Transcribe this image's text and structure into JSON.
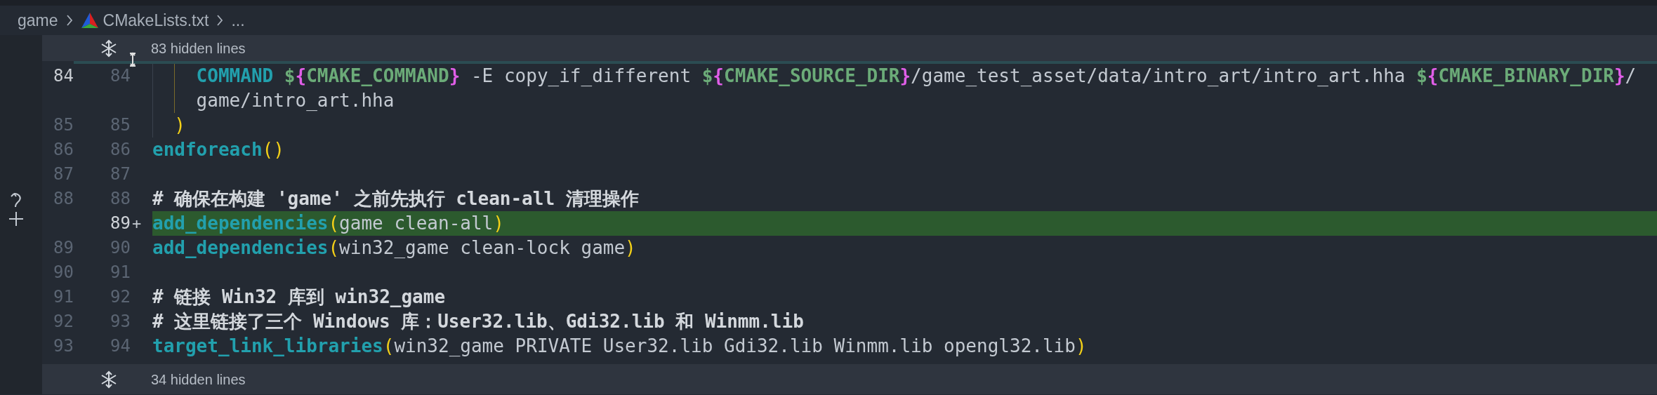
{
  "breadcrumb": [
    {
      "kind": "folder",
      "label": "game"
    },
    {
      "kind": "file",
      "label": "CMakeLists.txt"
    },
    {
      "kind": "more",
      "label": "..."
    }
  ],
  "fold_top": {
    "label": "83 hidden lines"
  },
  "rows": [
    {
      "kind": "context",
      "old": "84",
      "new": "84",
      "cursor": true,
      "tokens": [
        {
          "kind": "keyword",
          "s": "    COMMAND"
        },
        {
          "kind": "var",
          "s": " $"
        },
        {
          "kind": "brace",
          "s": "{"
        },
        {
          "kind": "var",
          "s": "CMAKE_COMMAND"
        },
        {
          "kind": "brace",
          "s": "}"
        },
        {
          "kind": "text",
          "s": " -E copy_if_different "
        },
        {
          "kind": "var",
          "s": "$"
        },
        {
          "kind": "brace",
          "s": "{"
        },
        {
          "kind": "var",
          "s": "CMAKE_SOURCE_DIR"
        },
        {
          "kind": "brace",
          "s": "}"
        },
        {
          "kind": "text",
          "s": "/game_test_asset/data/intro_art/intro_art.hha "
        },
        {
          "kind": "var",
          "s": "$"
        },
        {
          "kind": "brace",
          "s": "{"
        },
        {
          "kind": "var",
          "s": "CMAKE_BINARY_DIR"
        },
        {
          "kind": "brace",
          "s": "}"
        },
        {
          "kind": "text",
          "s": "/"
        }
      ]
    },
    {
      "kind": "wrap",
      "tokens": [
        {
          "kind": "text",
          "s": "    game/intro_art.hha"
        }
      ]
    },
    {
      "kind": "context",
      "old": "85",
      "new": "85",
      "cursor": false,
      "tokens": [
        {
          "kind": "paren",
          "s": "  )"
        }
      ]
    },
    {
      "kind": "context",
      "old": "86",
      "new": "86",
      "cursor": false,
      "tokens": [
        {
          "kind": "keyword",
          "s": "endforeach"
        },
        {
          "kind": "paren",
          "s": "()"
        }
      ]
    },
    {
      "kind": "context",
      "old": "87",
      "new": "87",
      "cursor": false,
      "tokens": []
    },
    {
      "kind": "context",
      "old": "88",
      "new": "88",
      "cursor": false,
      "tokens": [
        {
          "kind": "comment",
          "s": "# 确保在构建 'game' 之前先执行 clean-all 清理操作"
        }
      ]
    },
    {
      "kind": "added",
      "new": "89",
      "marker": "+",
      "tokens": [
        {
          "kind": "keyword",
          "s": "add_dependencies"
        },
        {
          "kind": "paren",
          "s": "("
        },
        {
          "kind": "text",
          "s": "game clean-all"
        },
        {
          "kind": "paren",
          "s": ")"
        }
      ]
    },
    {
      "kind": "context",
      "old": "89",
      "new": "90",
      "cursor": false,
      "tokens": [
        {
          "kind": "keyword",
          "s": "add_dependencies"
        },
        {
          "kind": "paren",
          "s": "("
        },
        {
          "kind": "text",
          "s": "win32_game clean-lock game"
        },
        {
          "kind": "paren",
          "s": ")"
        }
      ]
    },
    {
      "kind": "context",
      "old": "90",
      "new": "91",
      "cursor": false,
      "tokens": []
    },
    {
      "kind": "context",
      "old": "91",
      "new": "92",
      "cursor": false,
      "tokens": [
        {
          "kind": "comment",
          "s": "# 链接 Win32 库到 win32_game"
        }
      ]
    },
    {
      "kind": "context",
      "old": "92",
      "new": "93",
      "cursor": false,
      "tokens": [
        {
          "kind": "comment",
          "s": "# 这里链接了三个 Windows 库：User32.lib、Gdi32.lib 和 Winmm.lib"
        }
      ]
    },
    {
      "kind": "context",
      "old": "93",
      "new": "94",
      "cursor": false,
      "tokens": [
        {
          "kind": "keyword",
          "s": "target_link_libraries"
        },
        {
          "kind": "paren",
          "s": "("
        },
        {
          "kind": "text",
          "s": "win32_game PRIVATE User32.lib Gdi32.lib Winmm.lib opengl32.lib"
        },
        {
          "kind": "paren",
          "s": ")"
        }
      ]
    }
  ],
  "fold_bottom": {
    "label": "34 hidden lines"
  }
}
